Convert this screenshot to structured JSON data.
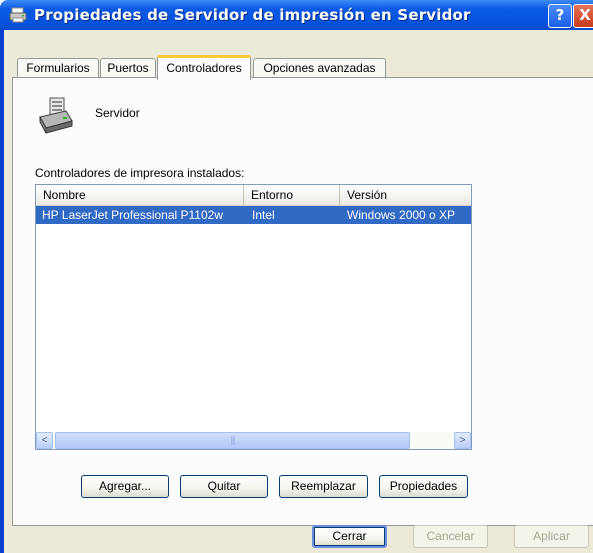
{
  "window": {
    "title": "Propiedades de Servidor de impresión en Servidor",
    "help_label": "?",
    "close_label": "X"
  },
  "tabs": [
    {
      "label": "Formularios",
      "active": false
    },
    {
      "label": "Puertos",
      "active": false
    },
    {
      "label": "Controladores",
      "active": true
    },
    {
      "label": "Opciones avanzadas",
      "active": false
    }
  ],
  "server": {
    "name": "Servidor",
    "icon": "printer-server-icon"
  },
  "drivers": {
    "caption": "Controladores de impresora instalados:",
    "columns": [
      "Nombre",
      "Entorno",
      "Versión"
    ],
    "rows": [
      {
        "name": "HP LaserJet Professional P1102w",
        "environment": "Intel",
        "version": "Windows 2000 o XP",
        "selected": true
      }
    ]
  },
  "scrollbar": {
    "left_arrow": "<",
    "right_arrow": ">",
    "grip": "|||"
  },
  "driver_buttons": {
    "add": "Agregar...",
    "remove": "Quitar",
    "replace": "Reemplazar",
    "properties": "Propiedades"
  },
  "dialog_buttons": {
    "close": "Cerrar",
    "cancel": "Cancelar",
    "apply": "Aplicar"
  },
  "colors": {
    "titlebar": "#0654df",
    "selection": "#316ac5",
    "dialog_bg": "#ece9d8",
    "active_tab_highlight": "#ffc83c"
  }
}
